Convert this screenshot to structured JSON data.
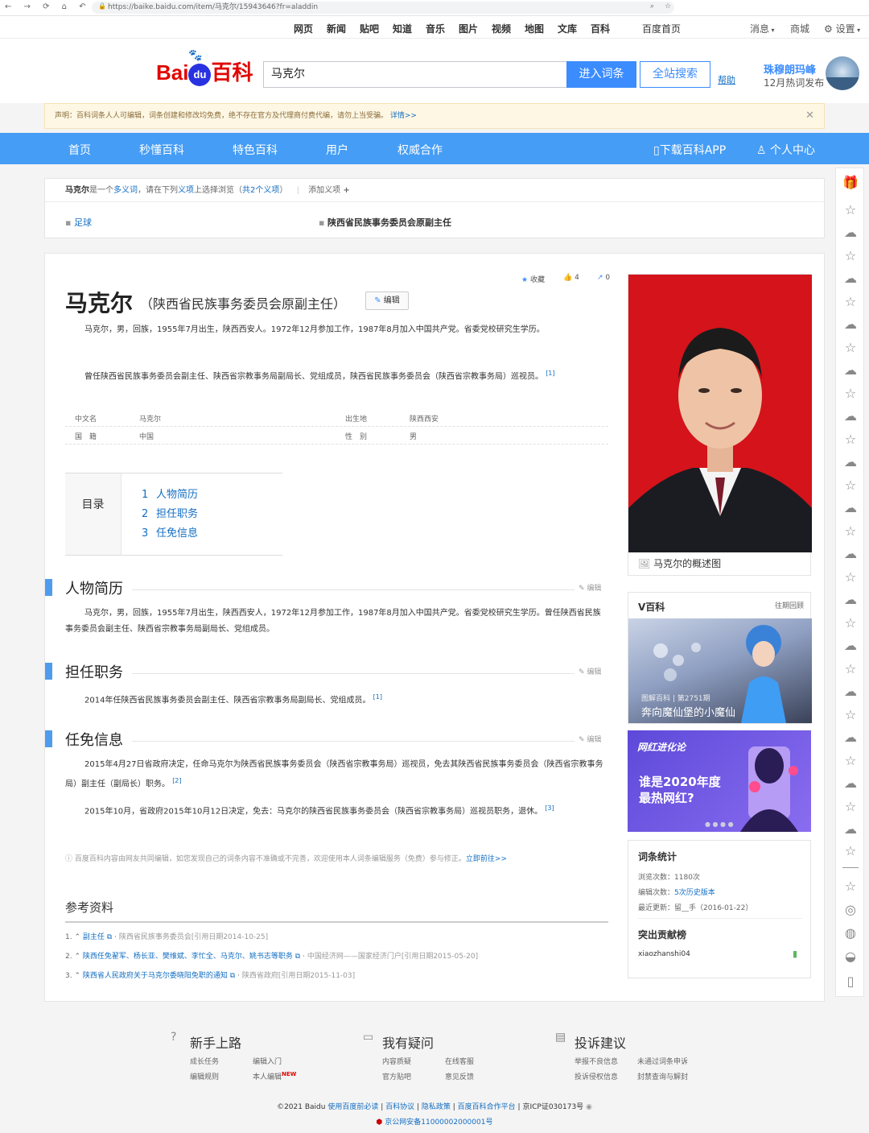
{
  "browser": {
    "url": "https://baike.baidu.com/item/马克尔/15943646?fr=aladdin"
  },
  "topnav": {
    "items": [
      "网页",
      "新闻",
      "贴吧",
      "知道",
      "音乐",
      "图片",
      "视频",
      "地图",
      "文库",
      "百科"
    ],
    "home": "百度首页",
    "msg": "消息",
    "mall": "商城",
    "settings": "设置"
  },
  "header": {
    "logo": "Bai百科",
    "search_value": "马克尔",
    "enter": "进入词条",
    "all_search": "全站搜索",
    "help": "帮助",
    "hot_title": "珠穆朗玛峰",
    "hot_sub": "12月热词发布"
  },
  "notice": {
    "text": "声明：百科词条人人可编辑，词条创建和修改均免费，绝不存在官方及代理商付费代编，请勿上当受骗。",
    "link": "详情>>"
  },
  "bluebar": {
    "items": [
      "首页",
      "秒懂百科",
      "特色百科",
      "用户",
      "权威合作"
    ],
    "app": "下载百科APP",
    "personal": "个人中心"
  },
  "disambig": {
    "name": "马克尔",
    "t1": "是一个",
    "t2": "多义词",
    "t3": "，请在下列",
    "t4": "义项",
    "t5": "上选择浏览（",
    "t6": "共2个义项",
    "t7": "）",
    "add": "添加义项",
    "s1": "足球",
    "s2": "陕西省民族事务委员会原副主任"
  },
  "article": {
    "title": "马克尔",
    "subtitle": "（陕西省民族事务委员会原副主任）",
    "edit": "编辑",
    "collect": "收藏",
    "likes": "4",
    "shares": "0",
    "p1": "马克尔，男，回族，1955年7月出生，陕西西安人。1972年12月参加工作，1987年8月加入中国共产党。省委党校研究生学历。",
    "p2": "曾任陕西省民族事务委员会副主任、陕西省宗教事务局副局长、党组成员，陕西省民族事务委员会（陕西省宗教事务局）巡视员。",
    "sup1": "[1]",
    "basic": {
      "k1": "中文名",
      "v1": "马克尔",
      "k2": "出生地",
      "v2": "陕西西安",
      "k3": "国　籍",
      "v3": "中国",
      "k4": "性　别",
      "v4": "男"
    },
    "toc_label": "目录",
    "toc": [
      {
        "n": "1",
        "t": "人物简历"
      },
      {
        "n": "2",
        "t": "担任职务"
      },
      {
        "n": "3",
        "t": "任免信息"
      }
    ],
    "sec1": "人物简历",
    "sec1_p": "马克尔，男，回族，1955年7月出生，陕西西安人，1972年12月参加工作，1987年8月加入中国共产党。省委党校研究生学历。曾任陕西省民族事务委员会副主任、陕西省宗教事务局副局长、党组成员。",
    "sec2": "担任职务",
    "sec2_p": "2014年任陕西省民族事务委员会副主任、陕西省宗教事务局副局长、党组成员。",
    "sec3": "任免信息",
    "sec3_p1": "2015年4月27日省政府决定，任命马克尔为陕西省民族事务委员会（陕西省宗教事务局）巡视员，免去其陕西省民族事务委员会（陕西省宗教事务局）副主任（副局长）职务。",
    "sup2": "[2]",
    "sec3_p2": "2015年10月，省政府2015年10月12日决定，免去：马克尔的陕西省民族事务委员会（陕西省宗教事务局）巡视员职务，退休。",
    "sup3": "[3]",
    "section_edit": "编辑",
    "info": "百度百科内容由网友共同编辑，如您发现自己的词条内容不准确或不完善，欢迎使用本人词条编辑服务（免费）参与修正。",
    "info_link": "立即前往>>",
    "refs_title": "参考资料",
    "refs": [
      {
        "n": "1.",
        "t": "副主任",
        "src": "陕西省民族事务委员会[引用日期2014-10-25]"
      },
      {
        "n": "2.",
        "t": "陕西任免翟军、杨长亚、樊维斌、李忙全、马克尔、姚书志等职务",
        "src": "中国经济网——国家经济门户[引用日期2015-05-20]"
      },
      {
        "n": "3.",
        "t": "陕西省人民政府关于马克尔委晓阳免职的通知",
        "src": "陕西省政府[引用日期2015-11-03]"
      }
    ]
  },
  "right": {
    "photo_caption": "马克尔的概述图",
    "v_title": "V百科",
    "v_more": "往期回顾",
    "v_issue": "图解百科 | 第2751期",
    "v_caption": "奔向魔仙堡的小魔仙",
    "banner_tag": "网红进化论",
    "banner_text": "谁是2020年度最热网红?",
    "stats_title": "词条统计",
    "views_label": "浏览次数：",
    "views": "1180次",
    "edits_label": "编辑次数：",
    "edits": "5次历史版本",
    "updated_label": "最近更新：",
    "updated": "留__手（2016-01-22）",
    "contrib_title": "突出贡献榜",
    "contrib_user": "xiaozhanshi04"
  },
  "footer": {
    "c1": "新手上路",
    "c1a": "成长任务",
    "c1b": "编辑入门",
    "c1c": "编辑规则",
    "c1d": "本人编辑",
    "new": "NEW",
    "c2": "我有疑问",
    "c2a": "内容质疑",
    "c2b": "在线客服",
    "c2c": "官方贴吧",
    "c2d": "意见反馈",
    "c3": "投诉建议",
    "c3a": "举报不良信息",
    "c3b": "未通过词条申诉",
    "c3c": "投诉侵权信息",
    "c3d": "封禁查询与解封",
    "copy1": "©2021 Baidu",
    "l1": "使用百度前必读",
    "l2": "百科协议",
    "l3": "隐私政策",
    "l4": "百度百科合作平台",
    "icp": "京ICP证030173号",
    "police": "京公网安备11000002000001号"
  },
  "colors": {
    "accent": "#459df5",
    "brand_red": "#e10601",
    "brand_blue": "#2932e1",
    "link": "#136ec2"
  }
}
